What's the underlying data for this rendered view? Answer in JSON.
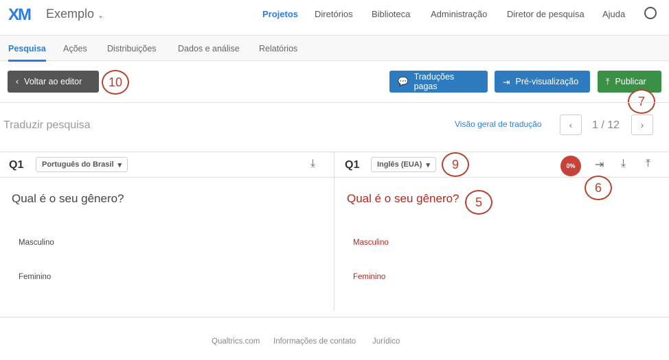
{
  "header": {
    "logo": "XM",
    "project": "Exemplo",
    "nav": [
      "Projetos",
      "Diretórios",
      "Biblioteca",
      "Administração",
      "Diretor de pesquisa",
      "Ajuda"
    ]
  },
  "tabs": [
    "Pesquisa",
    "Ações",
    "Distribuições",
    "Dados e análise",
    "Relatórios"
  ],
  "toolbar": {
    "back": "Voltar ao editor",
    "paid": "Traduções pagas",
    "preview": "Pré-visualização",
    "publish": "Publicar"
  },
  "translate": {
    "title": "Traduzir pesquisa",
    "overview": "Visão geral de tradução",
    "page": "1 / 12"
  },
  "left": {
    "q": "Q1",
    "lang": "Português do Brasil",
    "question": "Qual é o seu gênero?",
    "choices": [
      "Masculino",
      "Feminino"
    ]
  },
  "right": {
    "q": "Q1",
    "lang": "Inglês (EUA)",
    "progress": "0%",
    "question": "Qual é o seu gênero?",
    "choices": [
      "Masculino",
      "Feminino"
    ]
  },
  "callouts": [
    "10",
    "7",
    "9",
    "6",
    "5"
  ],
  "footer": [
    "Qualtrics.com",
    "Informações de contato",
    "Jurídico"
  ]
}
